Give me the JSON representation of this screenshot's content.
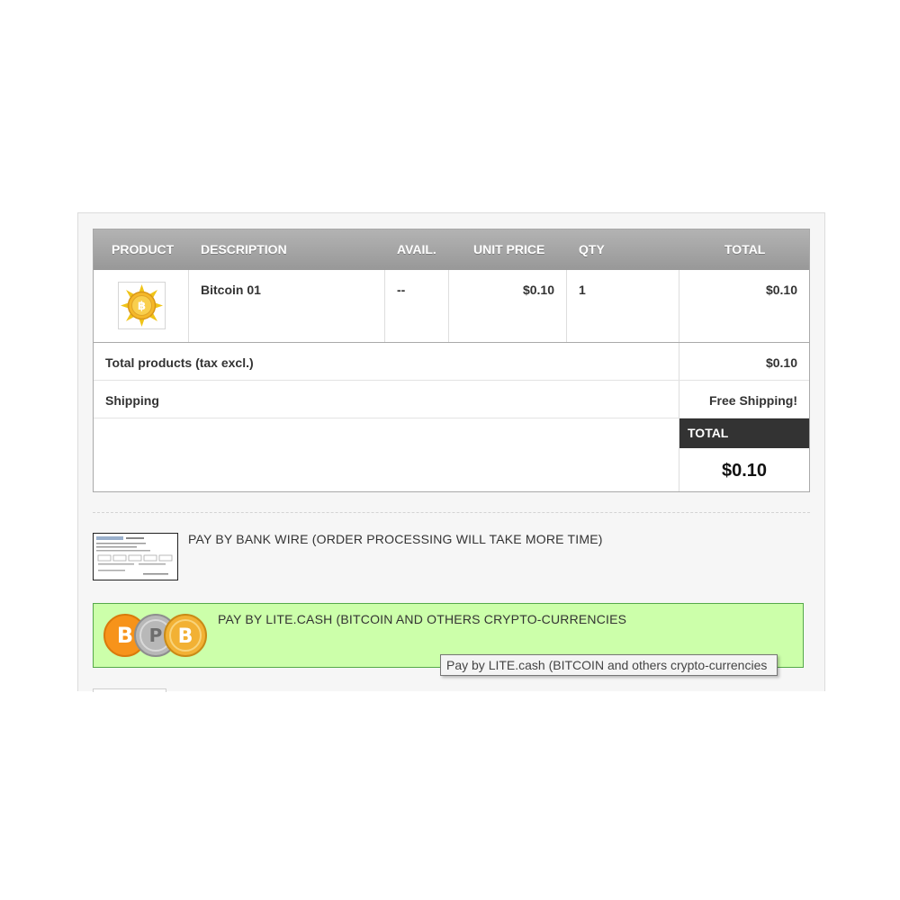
{
  "cart": {
    "columns": [
      "PRODUCT",
      "DESCRIPTION",
      "AVAIL.",
      "UNIT PRICE",
      "QTY",
      "TOTAL"
    ],
    "row": {
      "product_icon": "bitcoin-sun-icon",
      "description": "Bitcoin 01",
      "avail": "--",
      "unit_price": "$0.10",
      "qty": "1",
      "total": "$0.10"
    },
    "subtotal_label": "Total products (tax excl.)",
    "subtotal_value": "$0.10",
    "shipping_label": "Shipping",
    "shipping_value": "Free Shipping!",
    "total_label": "TOTAL",
    "total_value": "$0.10"
  },
  "payment": {
    "bank_wire": {
      "icon": "bank-wire-check-icon",
      "label": "PAY BY BANK WIRE (ORDER PROCESSING WILL TAKE MORE TIME)"
    },
    "lite_cash": {
      "icon": "crypto-coins-icon",
      "label": "PAY BY LITE.CASH (BITCOIN AND OTHERS CRYPTO-CURRENCIES",
      "tooltip": "Pay by LITE.cash (BITCOIN and others crypto-currencies"
    }
  },
  "colors": {
    "header_gray": "#a5a5a5",
    "total_dark": "#333333",
    "lite_highlight": "#ccffaa",
    "lite_border": "#55a94a"
  }
}
